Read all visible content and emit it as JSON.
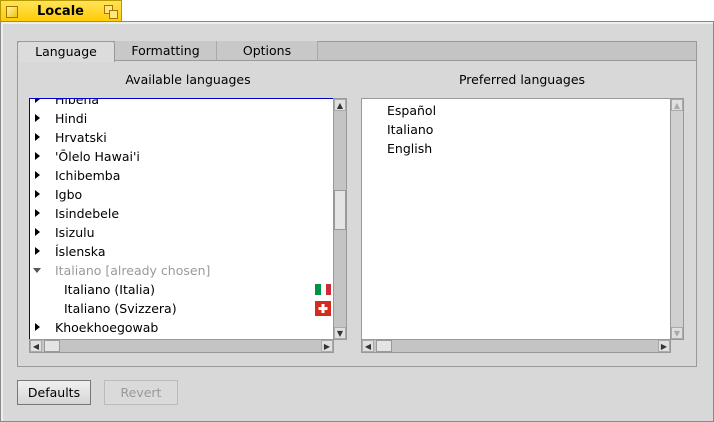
{
  "window": {
    "title": "Locale"
  },
  "tabs": [
    {
      "label": "Language",
      "active": true
    },
    {
      "label": "Formatting"
    },
    {
      "label": "Options"
    }
  ],
  "available": {
    "label": "Available languages",
    "items": [
      {
        "label": "Hibena"
      },
      {
        "label": "Hindi"
      },
      {
        "label": "Hrvatski"
      },
      {
        "label": "'Ōlelo Hawai'i"
      },
      {
        "label": "Ichibemba"
      },
      {
        "label": "Igbo"
      },
      {
        "label": "Isindebele"
      },
      {
        "label": "Isizulu"
      },
      {
        "label": "Íslenska"
      },
      {
        "label": "Italiano    [already chosen]",
        "expanded": true,
        "dim": true
      },
      {
        "label": "Italiano (Italia)",
        "child": true,
        "flag": "italy"
      },
      {
        "label": "Italiano (Svizzera)",
        "child": true,
        "flag": "switzerland"
      },
      {
        "label": "Khoekhoegowab"
      }
    ]
  },
  "preferred": {
    "label": "Preferred languages",
    "items": [
      "Español",
      "Italiano",
      "English"
    ]
  },
  "buttons": {
    "defaults": "Defaults",
    "revert": "Revert"
  },
  "colors": {
    "title_tab": "#ffcb00",
    "focus": "#0000c0"
  }
}
